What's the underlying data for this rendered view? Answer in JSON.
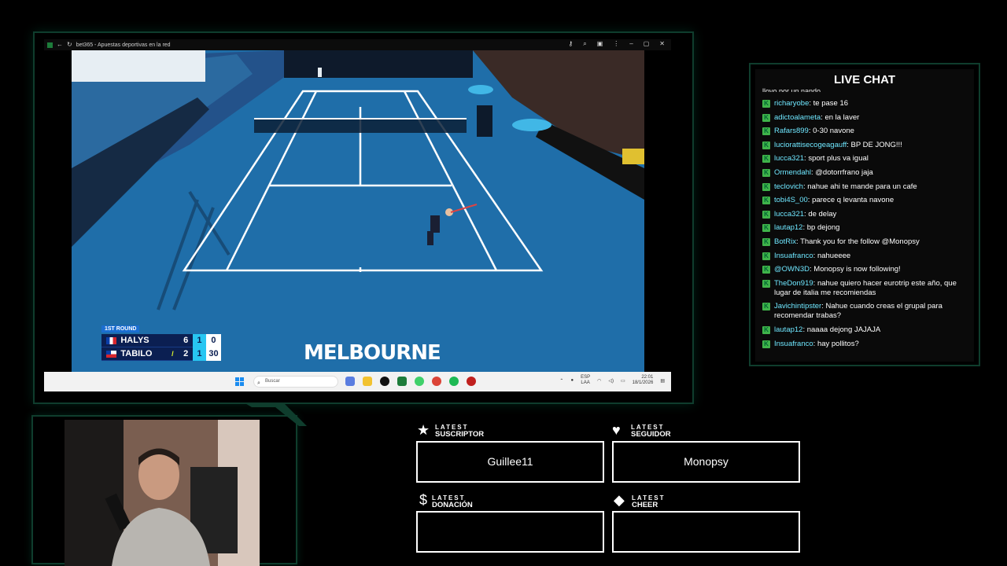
{
  "window": {
    "title": "bet365 - Apuestas deportivas en la red",
    "controls": [
      "minimize",
      "maximize",
      "close"
    ]
  },
  "scoreboard": {
    "round": "1ST ROUND",
    "players": [
      {
        "name": "HALYS",
        "flag": "france",
        "serving": false,
        "set1": "6",
        "set2": "1",
        "points": "0"
      },
      {
        "name": "TABILO",
        "flag": "chile",
        "serving": true,
        "set1": "2",
        "set2": "1",
        "points": "30"
      }
    ]
  },
  "watermark": "MELBOURNE",
  "taskbar": {
    "search_placeholder": "Buscar",
    "lang_top": "ESP",
    "lang_bottom": "LAA",
    "time": "22:01",
    "date": "18/1/2026"
  },
  "chat": {
    "title": "LIVE CHAT",
    "cut_line": "llovo por un nando",
    "messages": [
      {
        "user": "richaryobe",
        "text": "te pase 16"
      },
      {
        "user": "adictoalameta",
        "text": "en la laver"
      },
      {
        "user": "Rafars899",
        "text": "0-30 navone"
      },
      {
        "user": "luciorattisecogeagauff",
        "text": "BP DE JONG!!!"
      },
      {
        "user": "lucca321",
        "text": "sport plus va igual"
      },
      {
        "user": "Ormendahl",
        "text": "@dotorrfrano jaja"
      },
      {
        "user": "teclovich",
        "text": "nahue ahi te mande para un cafe"
      },
      {
        "user": "tobi4S_00",
        "text": "parece q levanta navone"
      },
      {
        "user": "lucca321",
        "text": "de delay"
      },
      {
        "user": "lautap12",
        "text": "bp dejong"
      },
      {
        "user": "BotRix",
        "text": "Thank you for the follow @Monopsy"
      },
      {
        "user": "Insuafranco",
        "text": "nahueeee"
      },
      {
        "user": "@OWN3D",
        "text": "Monopsy is now following!"
      },
      {
        "user": "TheDon919",
        "text": "nahue quiero hacer eurotrip este año, que lugar de italia me recomiendas"
      },
      {
        "user": "Javichintipster",
        "text": "Nahue cuando creas el grupal para recomendar trabas?"
      },
      {
        "user": "lautap12",
        "text": "naaaa dejong JAJAJA"
      },
      {
        "user": "Insuafranco",
        "text": "hay pollitos?"
      }
    ]
  },
  "events": {
    "subscriber": {
      "label_small": "LATEST",
      "label": "SUSCRIPTOR",
      "value": "Guillee11",
      "icon": "star-icon"
    },
    "follower": {
      "label_small": "LATEST",
      "label": "SEGUIDOR",
      "value": "Monopsy",
      "icon": "heart-icon"
    },
    "donation": {
      "label_small": "LATEST",
      "label": "DONACIÓN",
      "value": "",
      "icon": "dollar-icon"
    },
    "cheer": {
      "label_small": "LATEST",
      "label": "CHEER",
      "value": "",
      "icon": "diamond-icon"
    }
  },
  "colors": {
    "accent": "#0f3d2d",
    "chat_user": "#6fe7ff",
    "badge": "#3fb34a",
    "court": "#1e6fa8"
  }
}
